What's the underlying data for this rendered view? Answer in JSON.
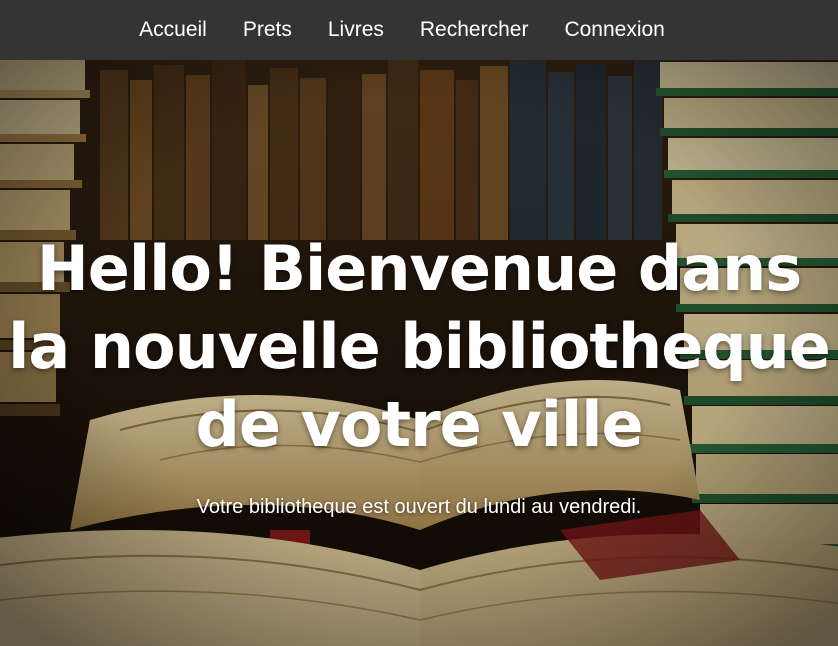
{
  "nav": {
    "items": [
      {
        "label": "Accueil"
      },
      {
        "label": "Prets"
      },
      {
        "label": "Livres"
      },
      {
        "label": "Rechercher"
      },
      {
        "label": "Connexion"
      }
    ]
  },
  "hero": {
    "headline": "Hello! Bienvenue dans la nouvelle bibliotheque de votre ville",
    "subtitle": "Votre bibliotheque est ouvert du lundi au vendredi.",
    "background": "library-books-photo"
  },
  "colors": {
    "navbar": "#343434",
    "text": "#ffffff",
    "book_green": "#2d6b3c",
    "book_paper": "#e8d3a0"
  }
}
